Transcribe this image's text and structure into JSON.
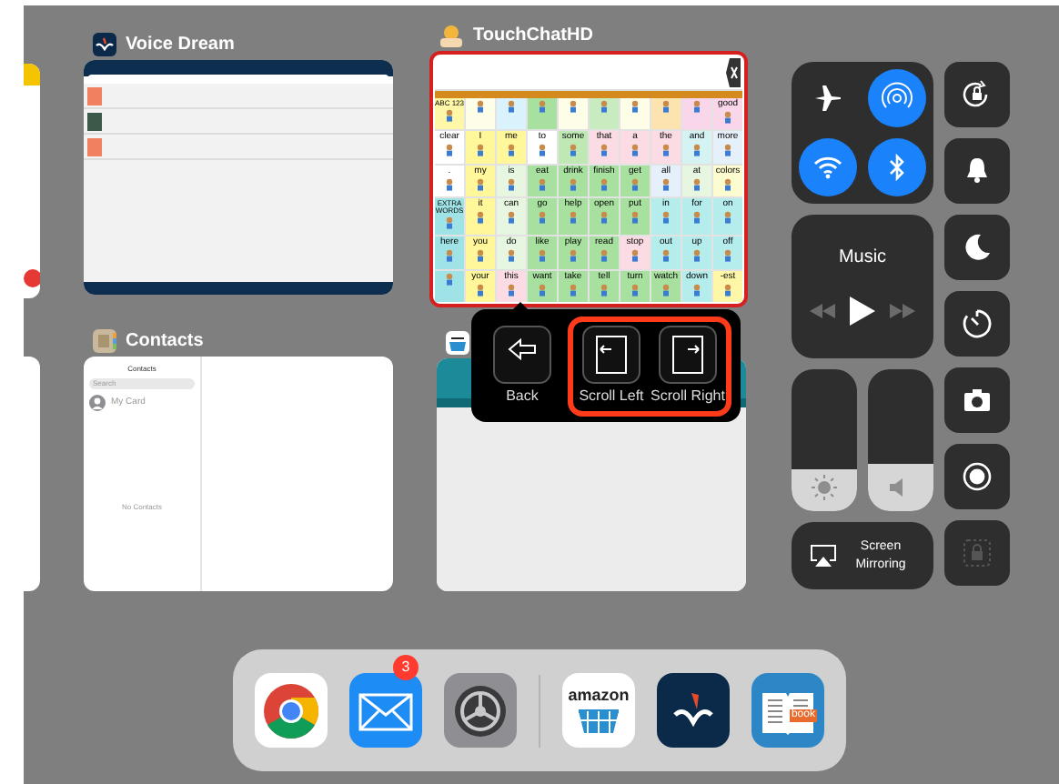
{
  "apps": [
    {
      "kind": "reader",
      "name": "Voice Dream",
      "selected": false
    },
    {
      "kind": "aac",
      "name": "TouchChatHD",
      "selected": true,
      "grid": {
        "rows": [
          [
            {
              "label": "ABC 123",
              "color": "#fff7a8"
            },
            {
              "color": "#fdfde8"
            },
            {
              "color": "#d9f2fb"
            },
            {
              "color": "#a8e0a0"
            },
            {
              "color": "#fdfde8"
            },
            {
              "color": "#c8ecc0"
            },
            {
              "color": "#fdfde8"
            },
            {
              "color": "#fde3b0"
            },
            {
              "color": "#f9d6ea"
            },
            {
              "label": "good",
              "color": "#f9d6ea"
            }
          ],
          [
            {
              "label": "clear",
              "color": "#ffffff"
            },
            {
              "label": "I",
              "color": "#fff79a"
            },
            {
              "label": "me",
              "color": "#fff79a"
            },
            {
              "label": "to",
              "color": "#ffffff"
            },
            {
              "label": "some",
              "color": "#bfe8b5"
            },
            {
              "label": "that",
              "color": "#fbdce4"
            },
            {
              "label": "a",
              "color": "#fbdce4"
            },
            {
              "label": "the",
              "color": "#fbdce4"
            },
            {
              "label": "and",
              "color": "#d6f3f3"
            },
            {
              "label": "more",
              "color": "#e6f0fa"
            }
          ],
          [
            {
              "label": ".",
              "color": "#ffffff"
            },
            {
              "label": "my",
              "color": "#fff79a"
            },
            {
              "label": "is",
              "color": "#e6f6e0"
            },
            {
              "label": "eat",
              "color": "#a8e0a0"
            },
            {
              "label": "drink",
              "color": "#a8e0a0"
            },
            {
              "label": "finish",
              "color": "#a8e0a0"
            },
            {
              "label": "get",
              "color": "#a8e0a0"
            },
            {
              "label": "all",
              "color": "#e6f0fa"
            },
            {
              "label": "at",
              "color": "#e6f6e0"
            },
            {
              "label": "colors",
              "color": "#fdfbd0"
            }
          ],
          [
            {
              "label": "EXTRA WORDS",
              "color": "#9fe3e6"
            },
            {
              "label": "it",
              "color": "#fff79a"
            },
            {
              "label": "can",
              "color": "#e6f6e0"
            },
            {
              "label": "go",
              "color": "#a8e0a0"
            },
            {
              "label": "help",
              "color": "#a8e0a0"
            },
            {
              "label": "open",
              "color": "#a8e0a0"
            },
            {
              "label": "put",
              "color": "#a8e0a0"
            },
            {
              "label": "in",
              "color": "#b5ecec"
            },
            {
              "label": "for",
              "color": "#b5ecec"
            },
            {
              "label": "on",
              "color": "#b5ecec"
            }
          ],
          [
            {
              "label": "here",
              "color": "#9fe3e6"
            },
            {
              "label": "you",
              "color": "#fff79a"
            },
            {
              "label": "do",
              "color": "#e6f6e0"
            },
            {
              "label": "like",
              "color": "#a8e0a0"
            },
            {
              "label": "play",
              "color": "#a8e0a0"
            },
            {
              "label": "read",
              "color": "#a8e0a0"
            },
            {
              "label": "stop",
              "color": "#fbdce4"
            },
            {
              "label": "out",
              "color": "#b5ecec"
            },
            {
              "label": "up",
              "color": "#b5ecec"
            },
            {
              "label": "off",
              "color": "#b5ecec"
            }
          ],
          [
            {
              "color": "#9fe3e6"
            },
            {
              "label": "your",
              "color": "#fff79a"
            },
            {
              "label": "this",
              "color": "#fbdce4"
            },
            {
              "label": "want",
              "color": "#a8e0a0"
            },
            {
              "label": "take",
              "color": "#a8e0a0"
            },
            {
              "label": "tell",
              "color": "#a8e0a0"
            },
            {
              "label": "turn",
              "color": "#a8e0a0"
            },
            {
              "label": "watch",
              "color": "#a8e0a0"
            },
            {
              "label": "down",
              "color": "#b5ecec"
            },
            {
              "label": "-est",
              "color": "#fff7a8"
            }
          ]
        ]
      }
    },
    {
      "kind": "contacts",
      "name": "Contacts",
      "selected": false,
      "header": "Contacts",
      "placeholder": "Search",
      "my_card": "My Card",
      "empty": "No Contacts"
    },
    {
      "kind": "store",
      "selected": false
    }
  ],
  "popup": {
    "items": [
      {
        "kind": "back",
        "label": "Back",
        "highlighted": false
      },
      {
        "kind": "scroll_left",
        "label": "Scroll Left",
        "highlighted": true
      },
      {
        "kind": "scroll_right",
        "label": "Scroll Right",
        "highlighted": true
      }
    ]
  },
  "control_center": {
    "connectivity": [
      {
        "kind": "airplane",
        "on": false
      },
      {
        "kind": "airdrop",
        "on": true
      },
      {
        "kind": "wifi",
        "on": true
      },
      {
        "kind": "bluetooth",
        "on": true
      }
    ],
    "music": {
      "title": "Music"
    },
    "brightness": {
      "level": 0.3
    },
    "volume": {
      "level": 0.33
    },
    "screen_mirroring": "Screen Mirroring",
    "toggles": [
      {
        "kind": "rotation_lock",
        "disabled": false
      },
      {
        "kind": "bell",
        "disabled": false
      },
      {
        "kind": "moon",
        "disabled": false
      },
      {
        "kind": "timer",
        "disabled": false
      },
      {
        "kind": "camera",
        "disabled": false
      },
      {
        "kind": "record",
        "disabled": false
      },
      {
        "kind": "lock",
        "disabled": true
      }
    ]
  },
  "dock": {
    "apps": [
      {
        "kind": "chrome"
      },
      {
        "kind": "mail",
        "badge": "3"
      },
      {
        "kind": "settings"
      }
    ],
    "recent": [
      {
        "kind": "store",
        "logo_text": "amazon"
      },
      {
        "kind": "reader"
      },
      {
        "kind": "book",
        "logo_text": "book"
      }
    ]
  }
}
